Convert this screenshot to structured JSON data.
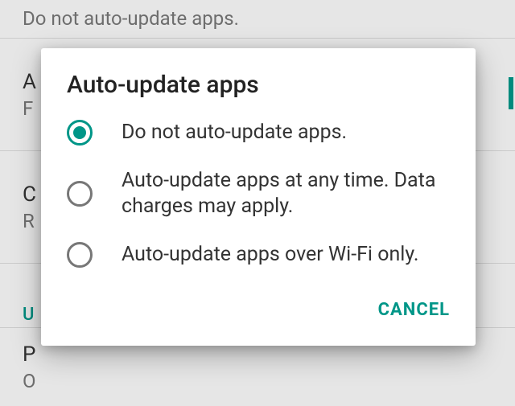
{
  "colors": {
    "accent": "#009688"
  },
  "background": {
    "item1_sub": "Do not auto-update apps.",
    "item2_title": "A",
    "item2_sub": "F",
    "item3_title": "C",
    "item3_sub": "R",
    "section_header": "U",
    "item5_title": "P",
    "item5_sub": "O"
  },
  "dialog": {
    "title": "Auto-update apps",
    "options": [
      {
        "label": "Do not auto-update apps.",
        "selected": true
      },
      {
        "label": "Auto-update apps at any time. Data charges may apply.",
        "selected": false
      },
      {
        "label": "Auto-update apps over Wi-Fi only.",
        "selected": false
      }
    ],
    "cancel_label": "CANCEL"
  }
}
